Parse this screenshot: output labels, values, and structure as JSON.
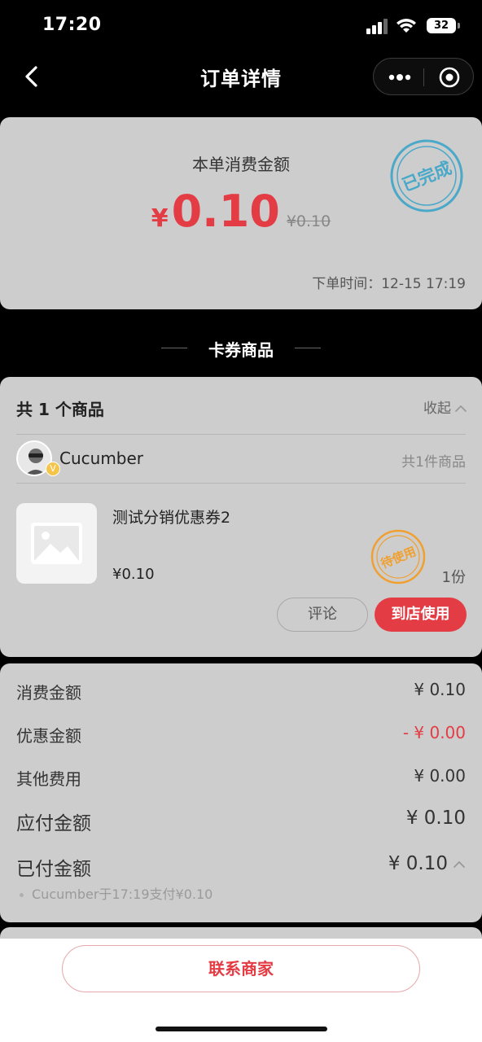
{
  "status_bar": {
    "time": "17:20",
    "battery": "32"
  },
  "nav": {
    "title": "订单详情"
  },
  "summary": {
    "label": "本单消费金额",
    "currency": "¥",
    "amount": "0.10",
    "original_amount": "¥0.10",
    "order_time_label": "下单时间：",
    "order_time": "12-15 17:19",
    "stamp_text": "已完成"
  },
  "section_title": "卡券商品",
  "products": {
    "count_label": "共 1 个商品",
    "collapse_label": "收起",
    "store": {
      "name": "Cucumber",
      "badge": "V",
      "item_count": "共1件商品"
    },
    "items": [
      {
        "name": "测试分销优惠券2",
        "price": "¥0.10",
        "quantity": "1份",
        "stamp_text": "待使用"
      }
    ],
    "review_label": "评论",
    "use_label": "到店使用"
  },
  "fees": {
    "consumption": {
      "label": "消费金额",
      "value": "¥ 0.10"
    },
    "discount": {
      "label": "优惠金额",
      "value": "- ¥ 0.00"
    },
    "other": {
      "label": "其他费用",
      "value": "¥ 0.00"
    },
    "payable": {
      "label": "应付金额",
      "value": "¥ 0.10"
    },
    "paid": {
      "label": "已付金额",
      "value": "¥ 0.10"
    },
    "payment_note": "Cucumber于17:19支付¥0.10"
  },
  "bottom": {
    "contact_label": "联系商家"
  },
  "colors": {
    "accent": "#e43c44",
    "card": "#cdcdcd",
    "stamp_blue": "#4aa8c8",
    "stamp_orange": "#f0a030"
  }
}
